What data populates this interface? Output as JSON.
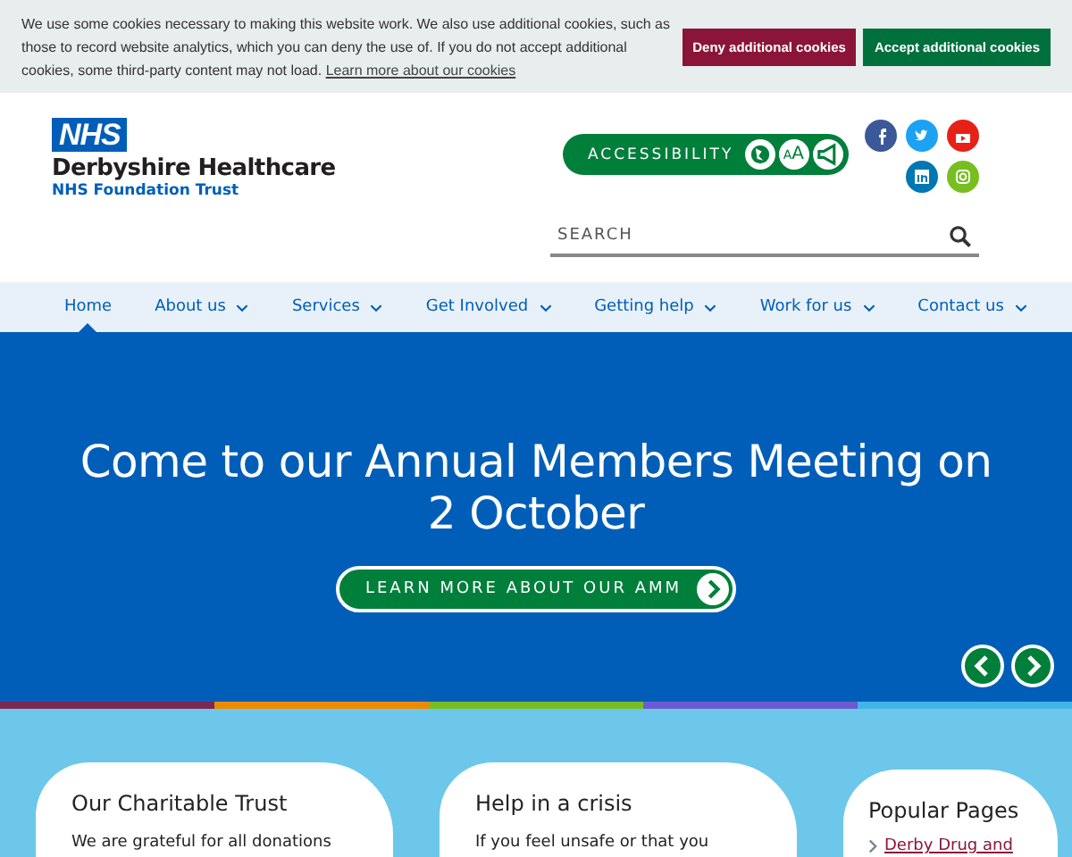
{
  "cookie_banner": {
    "text": "We use some cookies necessary to making this website work. We also use additional cookies, such as those to record website analytics, which you can deny the use of. If you do not accept additional cookies, some third-party content may not load.",
    "link": "Learn more about our cookies",
    "buttons": [
      {
        "label": "Deny additional cookies",
        "kind": "deny"
      },
      {
        "label": "Accept additional cookies",
        "kind": "accept"
      }
    ]
  },
  "logo": {
    "badge": "NHS",
    "name": "Derbyshire Healthcare",
    "subtitle": "NHS Foundation Trust"
  },
  "accessibility": {
    "label": "ACCESSIBILITY",
    "tools": [
      {
        "kind": "globe"
      },
      {
        "kind": "text-size",
        "label": "AA"
      },
      {
        "kind": "speaker"
      }
    ]
  },
  "social": [
    {
      "kind": "facebook",
      "color": "#3b5998"
    },
    {
      "kind": "twitter",
      "color": "#1da1f2"
    },
    {
      "kind": "youtube",
      "color": "#e62117"
    },
    {
      "kind": "linkedin",
      "color": "#0077b5"
    },
    {
      "kind": "instagram",
      "color": "#78be20"
    }
  ],
  "search": {
    "placeholder": "SEARCH"
  },
  "nav": [
    {
      "label": "Home",
      "selected": true,
      "has_menu": false
    },
    {
      "label": "About us",
      "selected": false,
      "has_menu": true
    },
    {
      "label": "Services",
      "selected": false,
      "has_menu": true
    },
    {
      "label": "Get Involved",
      "selected": false,
      "has_menu": true
    },
    {
      "label": "Getting help",
      "selected": false,
      "has_menu": true
    },
    {
      "label": "Work for us",
      "selected": false,
      "has_menu": true
    },
    {
      "label": "Contact us",
      "selected": false,
      "has_menu": true
    }
  ],
  "hero": {
    "title": "Come to our Annual Members Meeting on 2 October",
    "button": "LEARN MORE ABOUT OUR AMM"
  },
  "stripe": [
    {
      "color": "#7c2855"
    },
    {
      "color": "#ed8b00"
    },
    {
      "color": "#78be20"
    },
    {
      "color": "#6b5bd2"
    },
    {
      "color": "#41b6e6"
    }
  ],
  "cards": [
    {
      "title": "Our Charitable Trust",
      "text": "We are grateful for all donations"
    },
    {
      "title": "Help in a crisis",
      "text": "If you feel unsafe or that you"
    }
  ],
  "popular": {
    "title": "Popular Pages",
    "links": [
      "Derby Drug and"
    ]
  }
}
